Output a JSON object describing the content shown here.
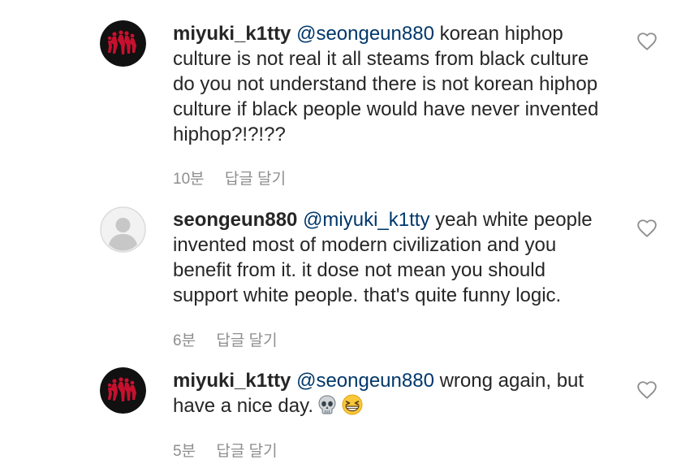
{
  "comments": [
    {
      "username": "miyuki_k1tty",
      "avatar": "red-dancers-avatar",
      "mention": "@seongeun880",
      "lines": [
        "korean hiphop",
        "culture is not real it all steams from black culture",
        "do you not understand there is not korean hiphop",
        "culture if black people would have never invented",
        "hiphop?!?!??"
      ],
      "time": "10분",
      "reply_label": "답글 달기",
      "like_icon": "heart-outline-icon"
    },
    {
      "username": "seongeun880",
      "avatar": "default-profile-avatar",
      "mention": "@miyuki_k1tty",
      "lines": [
        "yeah white people",
        "invented most of modern civilization and you",
        "benefit from it. it dose not mean you should",
        "support white people. that's quite funny logic."
      ],
      "time": "6분",
      "reply_label": "답글 달기",
      "like_icon": "heart-outline-icon"
    },
    {
      "username": "miyuki_k1tty",
      "avatar": "red-dancers-avatar",
      "mention": "@seongeun880",
      "lines": [
        "wrong again, but",
        "have a nice day."
      ],
      "emojis": [
        "skull-emoji",
        "grinning-squinting-face-emoji"
      ],
      "time": "5분",
      "reply_label": "답글 달기",
      "like_icon": "heart-outline-icon"
    }
  ]
}
